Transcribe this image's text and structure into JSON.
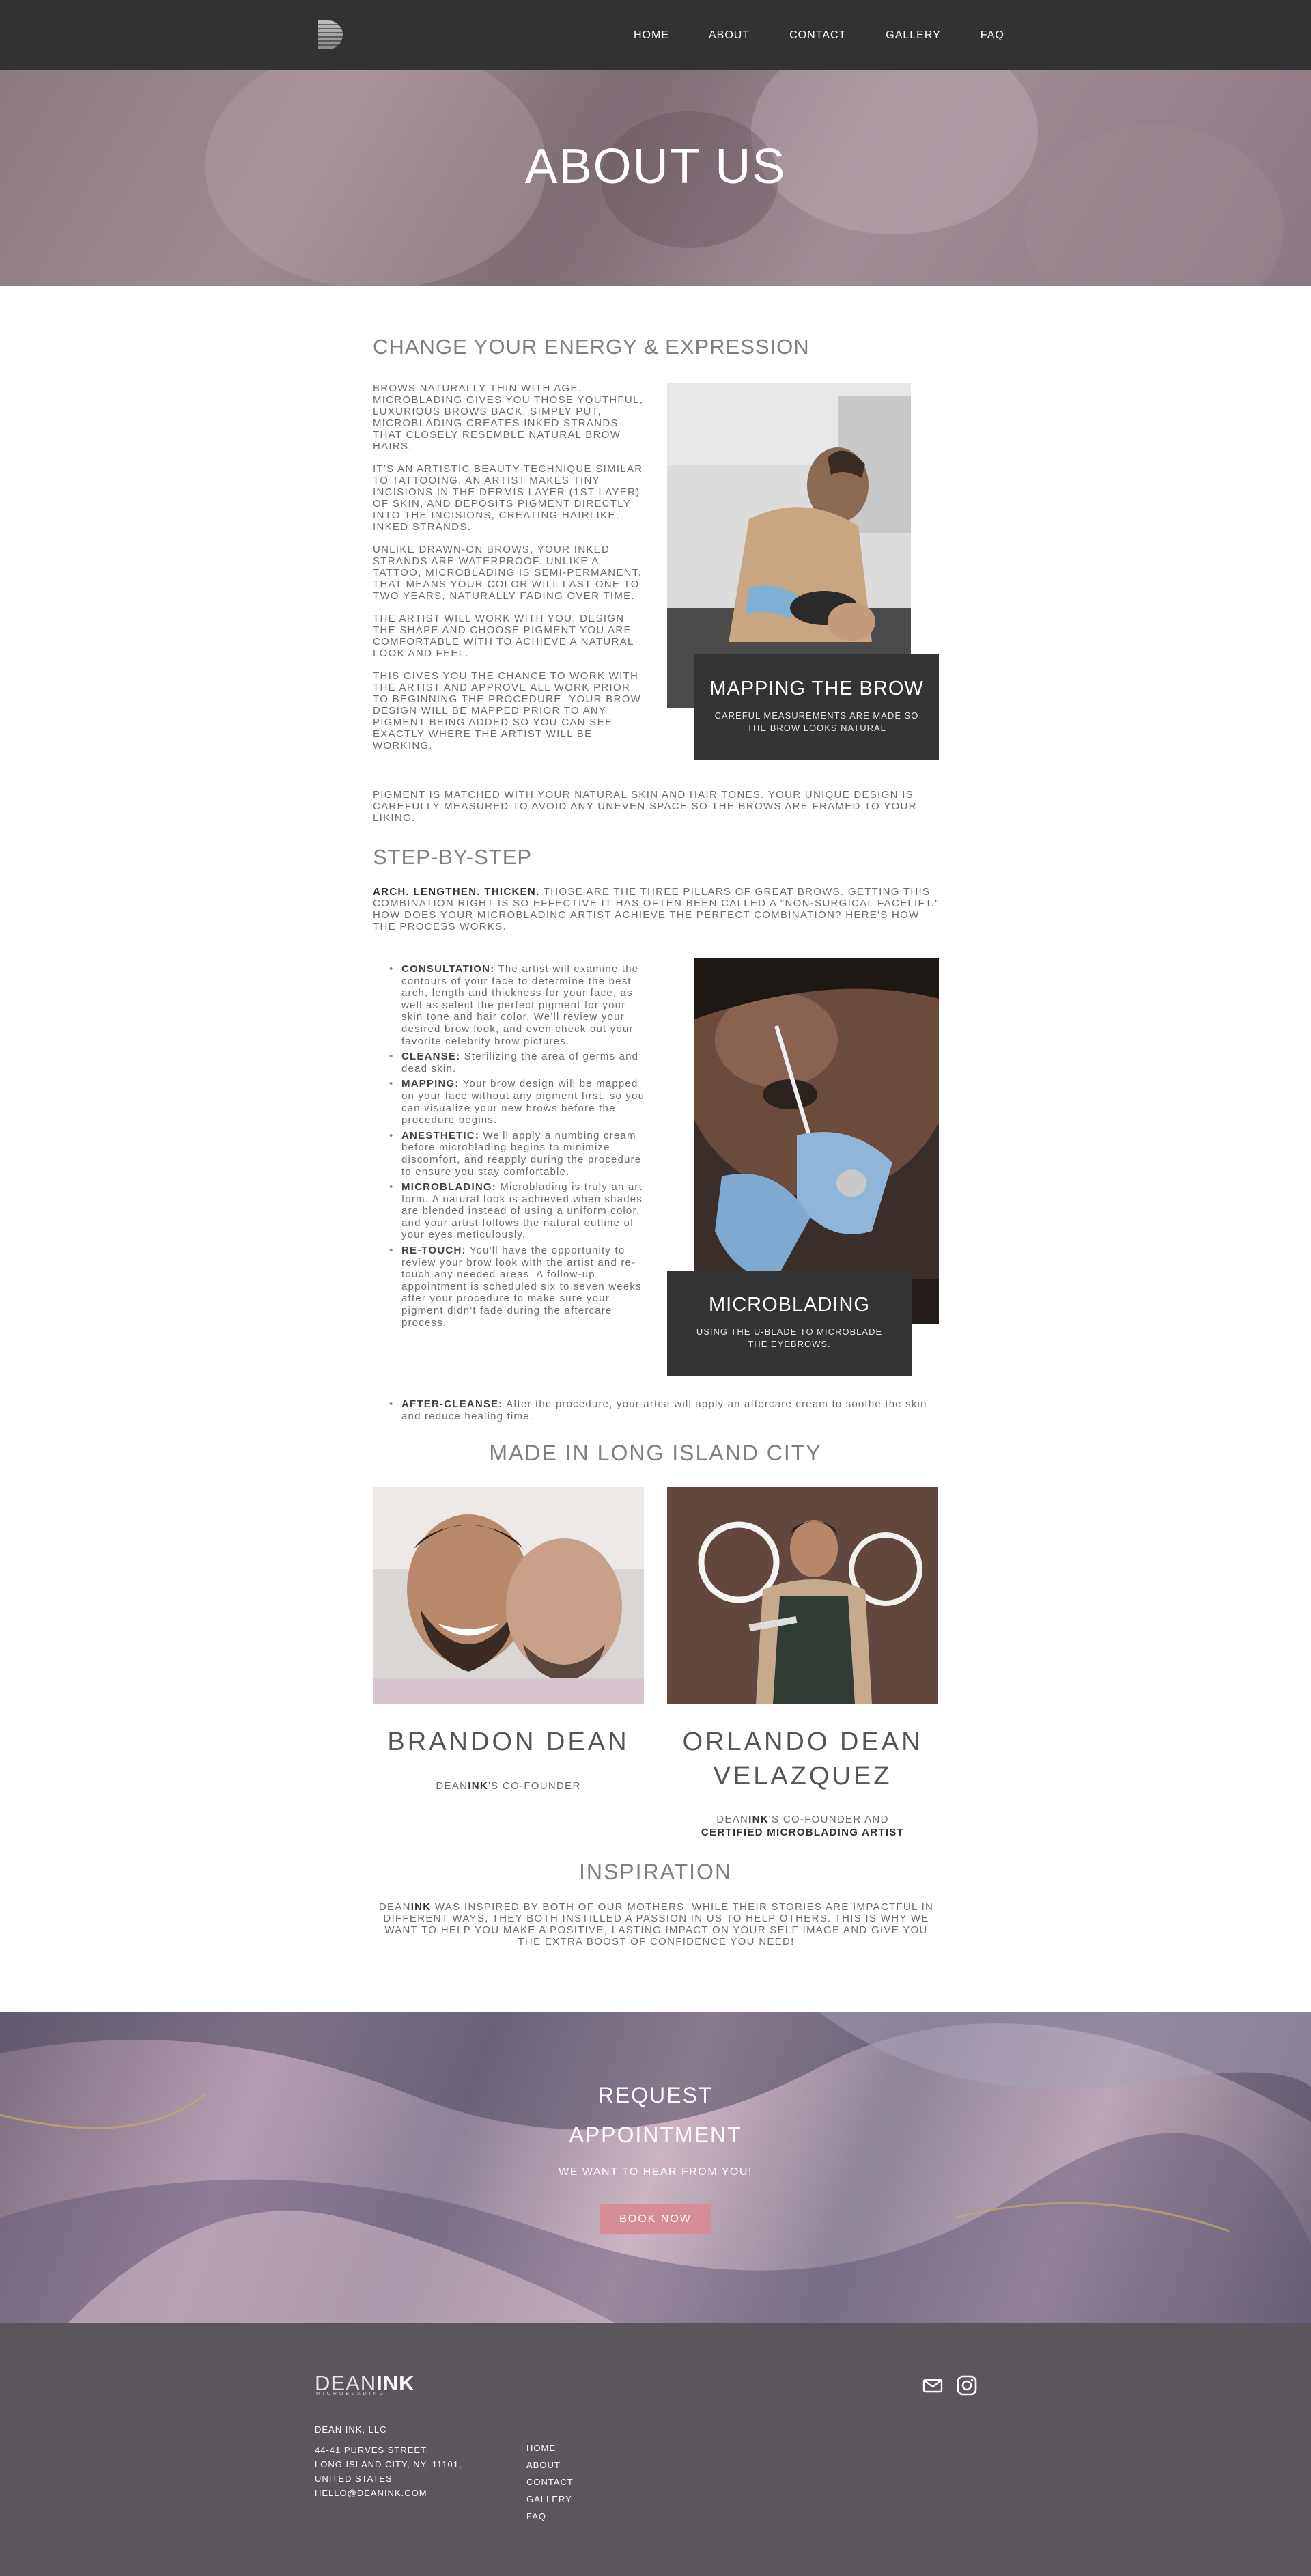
{
  "nav": {
    "logo_alt": "D",
    "links": [
      "HOME",
      "ABOUT",
      "CONTACT",
      "GALLERY",
      "FAQ"
    ]
  },
  "hero": {
    "title": "ABOUT US"
  },
  "section1": {
    "heading": "CHANGE YOUR ENERGY & EXPRESSION",
    "paragraphs": [
      "BROWS NATURALLY THIN WITH AGE. MICROBLADING GIVES YOU THOSE YOUTHFUL, LUXURIOUS BROWS BACK. SIMPLY PUT, MICROBLADING CREATES INKED STRANDS THAT CLOSELY RESEMBLE NATURAL BROW HAIRS.",
      "IT'S AN ARTISTIC BEAUTY TECHNIQUE SIMILAR TO TATTOOING. AN ARTIST MAKES TINY INCISIONS IN THE DERMIS LAYER (1ST LAYER) OF SKIN, AND DEPOSITS PIGMENT DIRECTLY INTO THE INCISIONS, CREATING HAIRLIKE, INKED STRANDS.",
      "UNLIKE DRAWN-ON BROWS, YOUR INKED STRANDS ARE WATERPROOF. UNLIKE A TATTOO, MICROBLADING IS SEMI-PERMANENT. THAT MEANS YOUR COLOR WILL LAST ONE TO TWO YEARS, NATURALLY FADING OVER TIME.",
      "THE ARTIST WILL WORK WITH YOU, DESIGN THE SHAPE AND CHOOSE PIGMENT YOU ARE COMFORTABLE WITH TO ACHIEVE A NATURAL LOOK AND FEEL.",
      "THIS GIVES YOU THE CHANCE TO WORK WITH THE ARTIST AND APPROVE ALL WORK PRIOR TO BEGINNING THE PROCEDURE. YOUR BROW DESIGN WILL BE MAPPED PRIOR TO ANY PIGMENT BEING ADDED SO YOU CAN SEE EXACTLY WHERE THE ARTIST WILL BE WORKING."
    ],
    "full_paragraph": "PIGMENT IS MATCHED WITH YOUR NATURAL SKIN AND HAIR TONES. YOUR UNIQUE DESIGN IS CAREFULLY MEASURED TO AVOID ANY UNEVEN SPACE SO THE BROWS ARE FRAMED TO YOUR LIKING.",
    "caption_title": "MAPPING THE BROW",
    "caption_sub": "CAREFUL MEASUREMENTS ARE MADE SO THE BROW LOOKS NATURAL"
  },
  "section2": {
    "heading": "STEP-BY-STEP",
    "intro_bold": "ARCH. LENGTHEN. THICKEN.",
    "intro_text": " THOSE ARE THE THREE PILLARS OF GREAT BROWS. GETTING THIS COMBINATION RIGHT IS SO EFFECTIVE IT HAS OFTEN BEEN CALLED A \"NON-SURGICAL FACELIFT.\" HOW DOES YOUR MICROBLADING ARTIST ACHIEVE THE PERFECT COMBINATION? HERE'S HOW THE PROCESS WORKS.",
    "steps": [
      {
        "title": "CONSULTATION:",
        "text": " The artist will examine the contours of your face to determine the best arch, length and thickness for your face, as well as select the perfect pigment for your skin tone and hair color. We'll review your desired brow look, and even check out your favorite celebrity brow pictures."
      },
      {
        "title": "CLEANSE:",
        "text": " Sterilizing the area of germs and dead skin."
      },
      {
        "title": "MAPPING:",
        "text": " Your brow design will be mapped on your face without any pigment first, so you can visualize your new brows before the procedure begins."
      },
      {
        "title": "ANESTHETIC:",
        "text": " We'll apply a numbing cream before microblading begins to minimize discomfort, and reapply during the procedure to ensure you stay comfortable."
      },
      {
        "title": "MICROBLADING:",
        "text": " Microblading is truly an art form. A natural look is achieved when shades are blended instead of using a uniform color, and your artist follows the natural outline of your eyes meticulously."
      },
      {
        "title": "RE-TOUCH:",
        "text": " You'll have the opportunity to review your brow look with the artist and re-touch any needed areas. A follow-up appointment is scheduled six to seven weeks after your procedure to make sure your pigment didn't fade during the aftercare process."
      },
      {
        "title": "AFTER-CLEANSE:",
        "text": " After the procedure, your artist will apply an aftercare cream to soothe the skin and reduce healing time."
      }
    ],
    "caption_title": "MICROBLADING",
    "caption_sub": "USING THE U-BLADE TO MICROBLADE THE EYEBROWS."
  },
  "section3": {
    "heading": "MADE IN LONG ISLAND CITY",
    "person1": {
      "name": "BRANDON DEAN",
      "role_pre": "DEAN",
      "role_bold": "INK",
      "role_post": "'s CO-FOUNDER"
    },
    "person2": {
      "name": "ORLANDO DEAN VELAZQUEZ",
      "role_pre": "DEAN",
      "role_bold": "INK",
      "role_post": "'s CO-FOUNDER AND",
      "role_line2": "CERTIFIED MICROBLADING ARTIST"
    }
  },
  "section4": {
    "heading": "INSPIRATION",
    "text_pre": "DEAN",
    "text_bold": "INK",
    "text_post": " WAS INSPIRED BY BOTH OF OUR MOTHERS. WHILE THEIR STORIES ARE IMPACTFUL IN DIFFERENT WAYS, THEY BOTH INSTILLED A PASSION IN US TO HELP OTHERS.  THIS IS WHY WE WANT TO HELP YOU MAKE A POSITIVE, LASTING IMPACT ON YOUR SELF IMAGE AND GIVE YOU THE EXTRA BOOST OF CONFIDENCE YOU NEED!"
  },
  "cta": {
    "title_line1": "REQUEST",
    "title_line2": "APPOINTMENT",
    "subtitle": "WE WANT TO HEAR FROM YOU!",
    "button": "BOOK NOW",
    "button_color": "#d78d97"
  },
  "footer": {
    "logo_thin": "DEAN",
    "logo_bold": "INK",
    "logo_sub": "MICROBLADING",
    "company": "DEAN INK, LLC",
    "address_lines": [
      "44-41 PURVES STREET,",
      "LONG ISLAND CITY, NY, 11101,",
      "UNITED STATES",
      "HELLO@DEANINK.COM"
    ],
    "links": [
      "HOME",
      "ABOUT",
      "CONTACT",
      "GALLERY",
      "FAQ"
    ],
    "social_icons": [
      "mail-icon",
      "instagram-icon"
    ]
  }
}
